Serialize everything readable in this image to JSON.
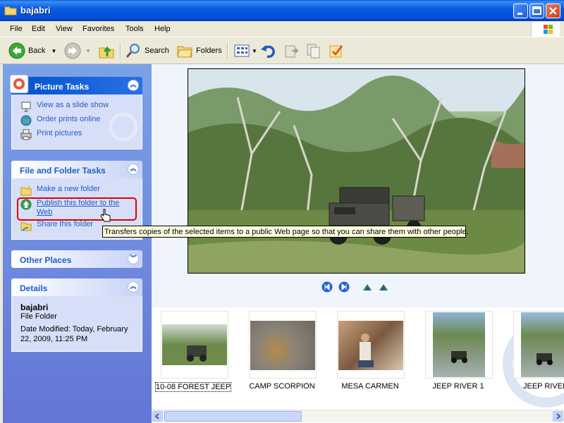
{
  "window": {
    "title": "bajabri"
  },
  "menu": [
    "File",
    "Edit",
    "View",
    "Favorites",
    "Tools",
    "Help"
  ],
  "toolbar": {
    "back": "Back",
    "search": "Search",
    "folders": "Folders"
  },
  "panels": {
    "picture_tasks": {
      "title": "Picture Tasks",
      "items": [
        "View as a slide show",
        "Order prints online",
        "Print pictures"
      ]
    },
    "file_folder_tasks": {
      "title": "File and Folder Tasks",
      "items": [
        "Make a new folder",
        "Publish this folder to the Web",
        "Share this folder"
      ]
    },
    "other_places": {
      "title": "Other Places"
    },
    "details": {
      "title": "Details",
      "name": "bajabri",
      "type": "File Folder",
      "modified": "Date Modified: Today, February 22, 2009, 11:25 PM"
    }
  },
  "tooltip": "Transfers copies of the selected items to a public Web page so that you can share them with other people.",
  "thumbnails": [
    "10-08 FOREST JEEP",
    "CAMP SCORPION",
    "MESA  CARMEN",
    "JEEP RIVER 1",
    "JEEP RIVER"
  ],
  "colors": {
    "titlebar": "#0450D8",
    "taskpane": "#6375D6",
    "link": "#215DC6",
    "highlight": "#E00000"
  }
}
